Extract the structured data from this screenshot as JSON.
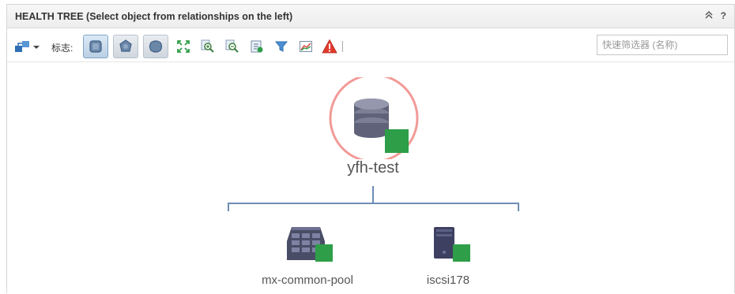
{
  "header": {
    "title": "HEALTH TREE (Select object from relationships on the left)",
    "collapse_label": "≈",
    "help_label": "?"
  },
  "toolbar": {
    "badge_label": "标志:",
    "filter_placeholder": "快速筛选器 (名称)",
    "filter_value": "",
    "buttons": [
      {
        "name": "layout-dropdown",
        "icon": "hierarchy-icon"
      },
      {
        "name": "badge-health",
        "icon": "health-badge-icon",
        "active": true
      },
      {
        "name": "badge-risk",
        "icon": "risk-badge-icon",
        "active": false
      },
      {
        "name": "badge-efficiency",
        "icon": "efficiency-badge-icon",
        "active": false
      },
      {
        "name": "fit-to-screen",
        "icon": "expand-arrows-icon"
      },
      {
        "name": "zoom-in",
        "icon": "zoom-in-icon"
      },
      {
        "name": "zoom-out",
        "icon": "zoom-out-icon"
      },
      {
        "name": "show-details",
        "icon": "details-icon"
      },
      {
        "name": "filter",
        "icon": "funnel-icon"
      },
      {
        "name": "metric-chart",
        "icon": "chart-icon"
      },
      {
        "name": "alerts",
        "icon": "alert-triangle-icon"
      }
    ]
  },
  "tree": {
    "root": {
      "label": "yfh-test",
      "icon": "datastore-icon",
      "health_color": "#2e9e48",
      "ring_color": "#f29a97"
    },
    "children": [
      {
        "label": "mx-common-pool",
        "icon": "storage-pool-icon",
        "health_color": "#2e9e48"
      },
      {
        "label": "iscsi178",
        "icon": "storage-server-icon",
        "health_color": "#2e9e48"
      }
    ],
    "connector_color": "#6e8db5"
  }
}
